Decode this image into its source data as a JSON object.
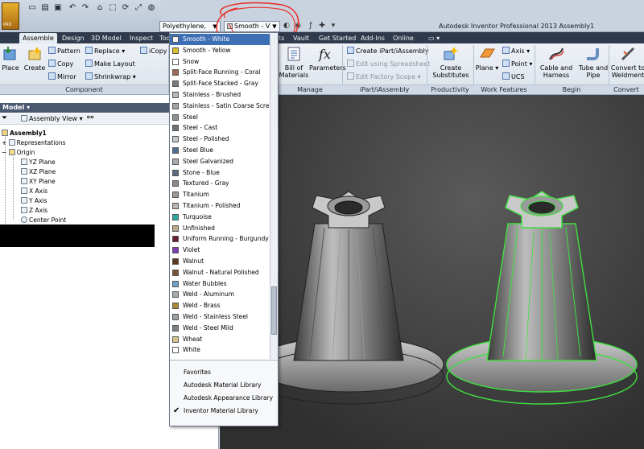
{
  "app": {
    "title": "Autodesk Inventor Professional 2013   Assembly1",
    "logo_text": "PRO"
  },
  "qat": {
    "material_value": "Polyethylene,",
    "appearance_value": "Smooth - V"
  },
  "ribbon_tabs": [
    "Assemble",
    "Design",
    "3D Model",
    "Inspect",
    "Too",
    "ts",
    "Vault",
    "Get Started",
    "Add-Ins",
    "Online"
  ],
  "ribbon": {
    "place": "Place",
    "create": "Create",
    "pattern": "Pattern",
    "copy": "Copy",
    "mirror": "Mirror",
    "replace": "Replace",
    "make_layout": "Make Layout",
    "shrinkwrap": "Shrinkwrap",
    "icopy": "iCopy",
    "component_group": "Component",
    "bill_of_materials": "Bill of Materials",
    "parameters": "Parameters",
    "manage_group": "Manage",
    "create_ipart": "Create iPart/iAssembly",
    "edit_spreadsheet": "Edit using Spreadsheet",
    "edit_factory": "Edit Factory Scope",
    "ipart_group": "iPart/iAssembly",
    "create_substitutes": "Create Substitutes",
    "productivity_group": "Productivity",
    "plane": "Plane",
    "axis": "Axis",
    "point": "Point",
    "ucs": "UCS",
    "work_features_group": "Work Features",
    "cable_harness": "Cable and Harness",
    "tube_pipe": "Tube and Pipe",
    "begin_group": "Begin",
    "convert_weldment": "Convert to Weldment",
    "convert_group": "Convert"
  },
  "browser": {
    "header": "Model",
    "assembly_view": "Assembly View",
    "tree": [
      {
        "label": "Assembly1",
        "level": 0
      },
      {
        "label": "Representations",
        "level": 1
      },
      {
        "label": "Origin",
        "level": 1
      },
      {
        "label": "YZ Plane",
        "level": 2
      },
      {
        "label": "XZ Plane",
        "level": 2
      },
      {
        "label": "XY Plane",
        "level": 2
      },
      {
        "label": "X Axis",
        "level": 2
      },
      {
        "label": "Y Axis",
        "level": 2
      },
      {
        "label": "Z Axis",
        "level": 2
      },
      {
        "label": "Center Point",
        "level": 2
      }
    ]
  },
  "dropdown": {
    "items": [
      {
        "label": "Smooth - White",
        "color": "#f2f2f2",
        "selected": true
      },
      {
        "label": "Smooth - Yellow",
        "color": "#d8c22a"
      },
      {
        "label": "Snow",
        "color": "#ffffff"
      },
      {
        "label": "Split-Face Running - Coral",
        "color": "#9c6a5a"
      },
      {
        "label": "Split-Face Stacked - Gray",
        "color": "#7a7a7a"
      },
      {
        "label": "Stainless - Brushed",
        "color": "#b4b8bc"
      },
      {
        "label": "Stainless - Satin Coarse Screen",
        "color": "#9ea3a8"
      },
      {
        "label": "Steel",
        "color": "#8d9196"
      },
      {
        "label": "Steel - Cast",
        "color": "#6d7176"
      },
      {
        "label": "Steel - Polished",
        "color": "#c3c7cc"
      },
      {
        "label": "Steel Blue",
        "color": "#4f6f8f"
      },
      {
        "label": "Steel Galvanized",
        "color": "#a7abaf"
      },
      {
        "label": "Stone - Blue",
        "color": "#5d6c80"
      },
      {
        "label": "Textured - Gray",
        "color": "#8a8a8a"
      },
      {
        "label": "Titanium",
        "color": "#9a9890"
      },
      {
        "label": "Titanium - Polished",
        "color": "#b8b5ad"
      },
      {
        "label": "Turquoise",
        "color": "#2aa6a0"
      },
      {
        "label": "Unfinished",
        "color": "#b9a98c"
      },
      {
        "label": "Uniform Running - Burgundy",
        "color": "#6b2030"
      },
      {
        "label": "Violet",
        "color": "#7a3fb0"
      },
      {
        "label": "Walnut",
        "color": "#5b3a22"
      },
      {
        "label": "Walnut - Natural Polished",
        "color": "#7a5234"
      },
      {
        "label": "Water Bubbles",
        "color": "#6c9fc8"
      },
      {
        "label": "Weld - Aluminum",
        "color": "#a6a9ac"
      },
      {
        "label": "Weld - Brass",
        "color": "#a88a3a"
      },
      {
        "label": "Weld - Stainless Steel",
        "color": "#9aa0a6"
      },
      {
        "label": "Weld - Steel Mild",
        "color": "#7f8388"
      },
      {
        "label": "Wheat",
        "color": "#d9c38e"
      },
      {
        "label": "White",
        "color": "#ffffff"
      }
    ],
    "libraries": [
      {
        "label": "Favorites",
        "checked": false
      },
      {
        "label": "Autodesk Material Library",
        "checked": false
      },
      {
        "label": "Autodesk Appearance Library",
        "checked": false
      },
      {
        "label": "Inventor Material Library",
        "checked": true
      }
    ]
  },
  "colors": {
    "selection_highlight": "#3d6fb4",
    "selected_outline": "#3fe03f",
    "ribbon_tab_bar": "#2f3a4c"
  }
}
